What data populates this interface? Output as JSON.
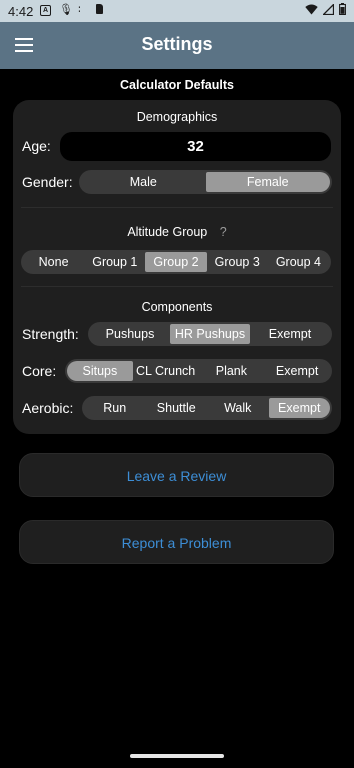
{
  "status_bar": {
    "time": "4:42",
    "icons_left": [
      "notification-a-icon",
      "mic-icon",
      "assistant-icon",
      "sim-card-icon"
    ],
    "icons_right": [
      "wifi-icon",
      "signal-icon",
      "battery-icon"
    ]
  },
  "app_bar": {
    "title": "Settings"
  },
  "section": {
    "title": "Calculator Defaults"
  },
  "demographics": {
    "title": "Demographics",
    "age_label": "Age:",
    "age_value": "32",
    "gender_label": "Gender:",
    "gender_options": [
      "Male",
      "Female"
    ],
    "gender_selected": "Female"
  },
  "altitude": {
    "title": "Altitude Group",
    "help": "?",
    "options": [
      "None",
      "Group 1",
      "Group 2",
      "Group 3",
      "Group 4"
    ],
    "selected": "Group 2"
  },
  "components": {
    "title": "Components",
    "strength_label": "Strength:",
    "strength_options": [
      "Pushups",
      "HR Pushups",
      "Exempt"
    ],
    "strength_selected": "HR Pushups",
    "core_label": "Core:",
    "core_options": [
      "Situps",
      "CL Crunch",
      "Plank",
      "Exempt"
    ],
    "core_selected": "Situps",
    "aerobic_label": "Aerobic:",
    "aerobic_options": [
      "Run",
      "Shuttle",
      "Walk",
      "Exempt"
    ],
    "aerobic_selected": "Exempt"
  },
  "actions": {
    "review_label": "Leave a Review",
    "problem_label": "Report a Problem"
  },
  "colors": {
    "app_bar": "#5b7385",
    "status_bar": "#c9d6dd",
    "card": "#1f1f1f",
    "selected_segment": "#9a9a9a",
    "link_blue": "#3d8ed6"
  }
}
